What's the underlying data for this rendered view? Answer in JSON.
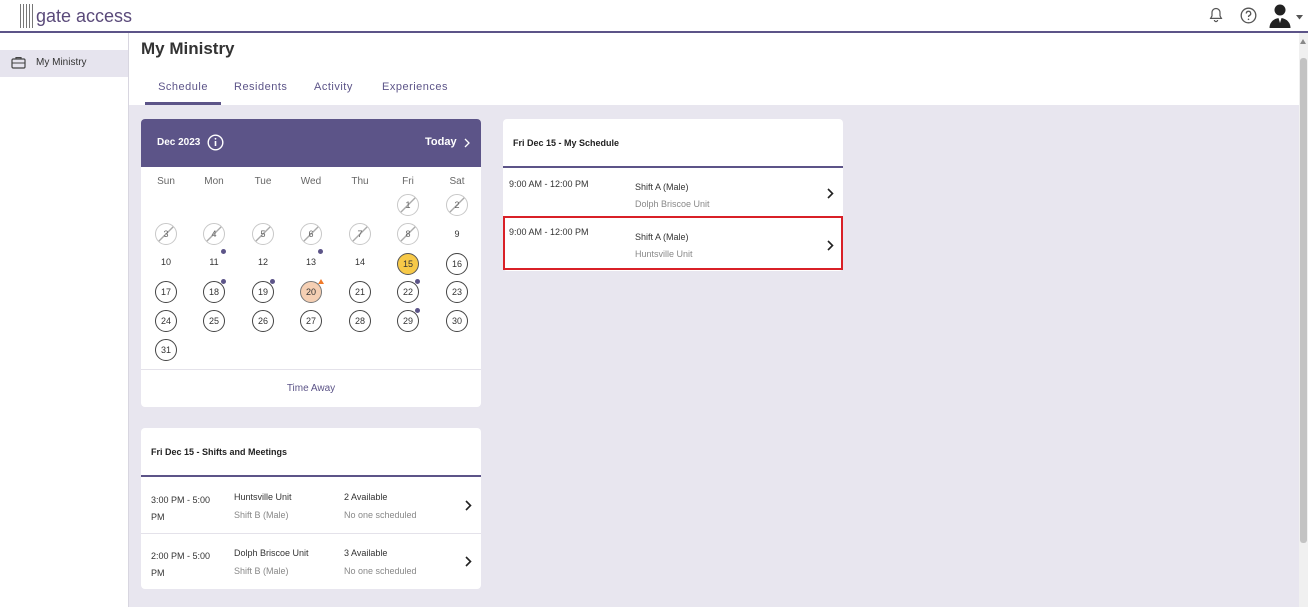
{
  "app": {
    "logo_text": "gate access",
    "icons": [
      "bell-icon",
      "help-icon",
      "avatar-icon",
      "caret-down-icon"
    ]
  },
  "sidebar": {
    "items": [
      {
        "label": "My Ministry",
        "icon": "briefcase-icon"
      }
    ]
  },
  "header": {
    "title": "My Ministry",
    "tabs": [
      {
        "label": "Schedule",
        "active": true
      },
      {
        "label": "Residents"
      },
      {
        "label": "Activity"
      },
      {
        "label": "Experiences"
      }
    ]
  },
  "calendar": {
    "month_label": "Dec 2023",
    "today_label": "Today",
    "weekdays": [
      "Sun",
      "Mon",
      "Tue",
      "Wed",
      "Thu",
      "Fri",
      "Sat"
    ],
    "days": [
      "1",
      "2",
      "3",
      "4",
      "5",
      "6",
      "7",
      "8",
      "9",
      "10",
      "11",
      "12",
      "13",
      "14",
      "15",
      "16",
      "17",
      "18",
      "19",
      "20",
      "21",
      "22",
      "23",
      "24",
      "25",
      "26",
      "27",
      "28",
      "29",
      "30",
      "31"
    ],
    "time_away_label": "Time Away",
    "colors": {
      "header": "#5c5488",
      "today": "#f7c948",
      "highlight": "#f5cfb3",
      "dot": "#5c5488",
      "alert": "#f07a2a"
    }
  },
  "shifts_meetings": {
    "title": "Fri Dec 15 - Shifts and Meetings",
    "rows": [
      {
        "time": "3:00 PM - 5:00 PM",
        "location": "Huntsville Unit",
        "shift": "Shift B (Male)",
        "available": "2 Available",
        "scheduled": "No one scheduled"
      },
      {
        "time": "2:00 PM - 5:00 PM",
        "location": "Dolph Briscoe Unit",
        "shift": "Shift B (Male)",
        "available": "3 Available",
        "scheduled": "No one scheduled"
      }
    ]
  },
  "my_schedule": {
    "title": "Fri Dec 15 - My Schedule",
    "rows": [
      {
        "time": "9:00 AM - 12:00 PM",
        "shift": "Shift A (Male)",
        "unit": "Dolph Briscoe Unit"
      },
      {
        "time": "9:00 AM - 12:00 PM",
        "shift": "Shift A (Male)",
        "unit": "Huntsville Unit",
        "selected": true
      }
    ]
  }
}
